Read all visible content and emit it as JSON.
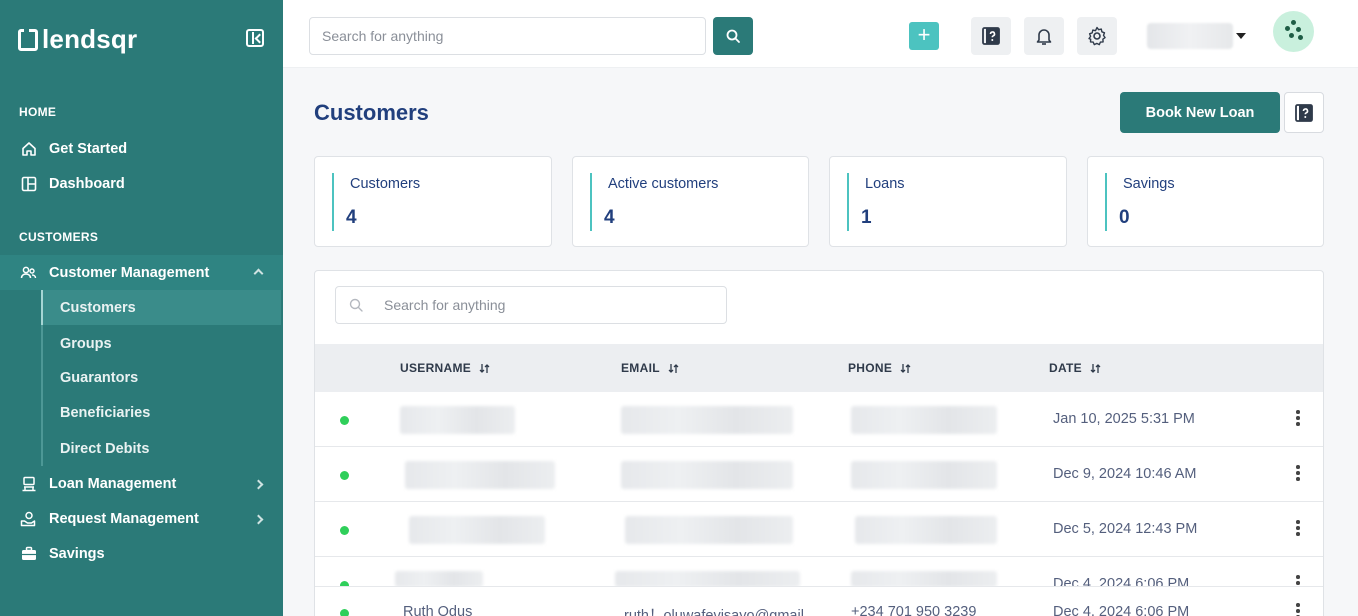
{
  "app": {
    "logo_text": "lendsqr"
  },
  "sidebar": {
    "sections": {
      "home": "HOME",
      "customers": "CUSTOMERS"
    },
    "home_items": [
      {
        "label": "Get Started",
        "icon": "home-icon"
      },
      {
        "label": "Dashboard",
        "icon": "dashboard-icon"
      }
    ],
    "customer_management": {
      "label": "Customer Management",
      "icon": "users-icon"
    },
    "sub_items": [
      {
        "label": "Customers",
        "active": true
      },
      {
        "label": "Groups"
      },
      {
        "label": "Guarantors"
      },
      {
        "label": "Beneficiaries"
      },
      {
        "label": "Direct Debits"
      }
    ],
    "more_items": [
      {
        "label": "Loan Management",
        "icon": "loan-icon"
      },
      {
        "label": "Request Management",
        "icon": "request-icon"
      },
      {
        "label": "Savings",
        "icon": "briefcase-icon"
      }
    ]
  },
  "topbar": {
    "search_placeholder": "Search for anything"
  },
  "page": {
    "title": "Customers",
    "book_button": "Book New Loan"
  },
  "stats": [
    {
      "label": "Customers",
      "value": "4"
    },
    {
      "label": "Active customers",
      "value": "4"
    },
    {
      "label": "Loans",
      "value": "1"
    },
    {
      "label": "Savings",
      "value": "0"
    }
  ],
  "table": {
    "search_placeholder": "Search for anything",
    "headers": {
      "username": "USERNAME",
      "email": "EMAIL",
      "phone": "PHONE",
      "date": "DATE"
    },
    "rows": [
      {
        "date": "Jan 10, 2025 5:31 PM"
      },
      {
        "date": "Dec 9, 2024 10:46 AM"
      },
      {
        "date": "Dec 5, 2024 12:43 PM"
      },
      {
        "date": "Dec 4, 2024 6:06 PM"
      },
      {
        "username": "Ruth Odus",
        "email": "ruth！oluwafevisayo@gmail.c",
        "phone": "+234 701 950 3239",
        "date": "Dec 4, 2024 6:06 PM"
      }
    ]
  },
  "colors": {
    "brand": "#2b7a78",
    "accent": "#4cc3c0",
    "title": "#213f7d",
    "status_active": "#2fcf5a"
  }
}
